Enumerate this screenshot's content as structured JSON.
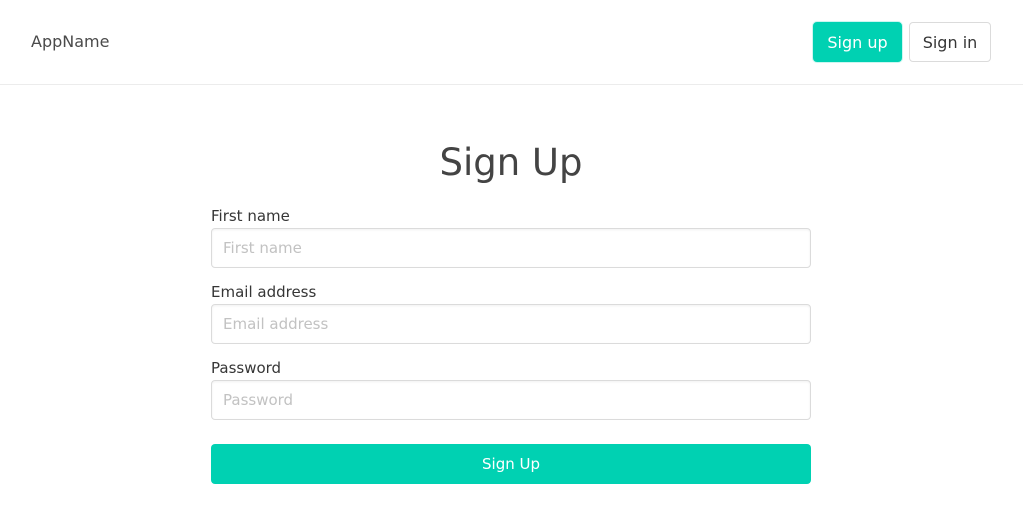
{
  "navbar": {
    "brand": "AppName",
    "signup_label": "Sign up",
    "signin_label": "Sign in"
  },
  "form": {
    "title": "Sign Up",
    "fields": [
      {
        "label": "First name",
        "placeholder": "First name",
        "value": ""
      },
      {
        "label": "Email address",
        "placeholder": "Email address",
        "value": ""
      },
      {
        "label": "Password",
        "placeholder": "Password",
        "value": ""
      }
    ],
    "submit_label": "Sign Up"
  },
  "colors": {
    "primary": "#00d1b2",
    "text": "#4a4a4a",
    "border": "#dbdbdb"
  }
}
